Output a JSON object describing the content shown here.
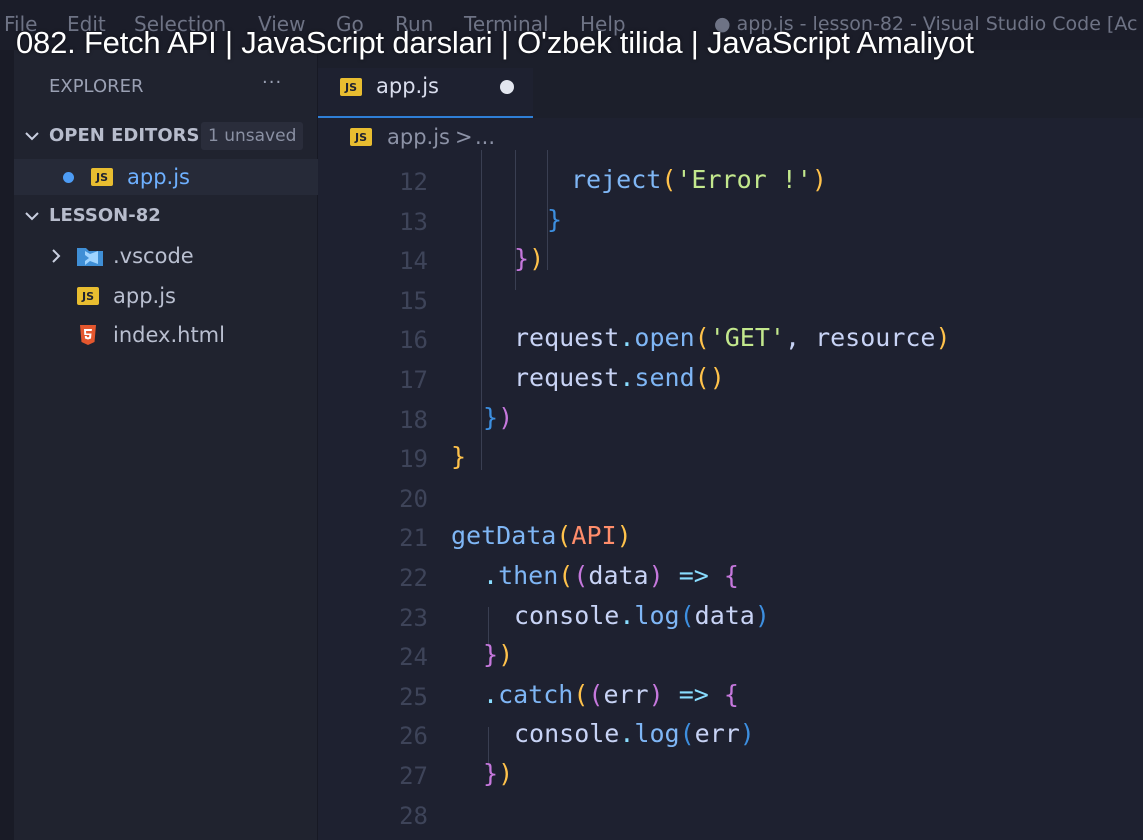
{
  "menu": {
    "items": [
      "File",
      "Edit",
      "Selection",
      "View",
      "Go",
      "Run",
      "Terminal",
      "Help"
    ],
    "window_title": "● app.js - lesson-82 - Visual Studio Code [Ac"
  },
  "video_title": "082. Fetch API | JavaScript darslari | O'zbek tilida | JavaScript Amaliyot",
  "sidebar": {
    "header": "EXPLORER",
    "more": "···",
    "open_editors": {
      "label": "OPEN EDITORS",
      "badge": "1 unsaved",
      "files": [
        {
          "name": "app.js",
          "icon": "js-file-icon",
          "unsaved": true
        }
      ]
    },
    "project": {
      "label": "LESSON-82",
      "items": [
        {
          "name": ".vscode",
          "icon": "vscode-folder-icon",
          "type": "folder"
        },
        {
          "name": "app.js",
          "icon": "js-file-icon",
          "type": "file"
        },
        {
          "name": "index.html",
          "icon": "html5-file-icon",
          "type": "file"
        }
      ]
    }
  },
  "editor": {
    "tab": {
      "label": "app.js",
      "icon": "js-file-icon",
      "unsaved": true
    },
    "breadcrumb": {
      "file": "app.js",
      "separator": ">",
      "more": "..."
    },
    "lines": [
      {
        "n": "12",
        "tokens": [
          [
            "reject",
            "fn"
          ],
          [
            "(",
            "p1"
          ],
          [
            "'Error !'",
            "str"
          ],
          [
            ")",
            "p1"
          ]
        ]
      },
      {
        "n": "13",
        "tokens": [
          [
            "}",
            "p3"
          ]
        ]
      },
      {
        "n": "14",
        "tokens": [
          [
            "}",
            "p2"
          ],
          [
            ")",
            "p1"
          ]
        ]
      },
      {
        "n": "15",
        "tokens": []
      },
      {
        "n": "16",
        "tokens": [
          [
            "request",
            "id"
          ],
          [
            ".",
            "op"
          ],
          [
            "open",
            "fn"
          ],
          [
            "(",
            "p1"
          ],
          [
            "'GET'",
            "str"
          ],
          [
            ", ",
            "pun"
          ],
          [
            "resource",
            "id"
          ],
          [
            ")",
            "p1"
          ]
        ]
      },
      {
        "n": "17",
        "tokens": [
          [
            "request",
            "id"
          ],
          [
            ".",
            "op"
          ],
          [
            "send",
            "fn"
          ],
          [
            "(",
            "p1"
          ],
          [
            ")",
            "p1"
          ]
        ]
      },
      {
        "n": "18",
        "tokens": [
          [
            "}",
            "p3"
          ],
          [
            ")",
            "p2"
          ]
        ]
      },
      {
        "n": "19",
        "tokens": [
          [
            "}",
            "p1"
          ]
        ]
      },
      {
        "n": "20",
        "tokens": []
      },
      {
        "n": "21",
        "tokens": [
          [
            "getData",
            "fn"
          ],
          [
            "(",
            "p1"
          ],
          [
            "API",
            "par"
          ],
          [
            ")",
            "p1"
          ]
        ]
      },
      {
        "n": "22",
        "tokens": [
          [
            ".",
            "op"
          ],
          [
            "then",
            "fn"
          ],
          [
            "(",
            "p1"
          ],
          [
            "(",
            "p2"
          ],
          [
            "data",
            "id"
          ],
          [
            ")",
            "p2"
          ],
          [
            " ",
            "pun"
          ],
          [
            "=>",
            "op"
          ],
          [
            " ",
            "pun"
          ],
          [
            "{",
            "p2"
          ]
        ]
      },
      {
        "n": "23",
        "tokens": [
          [
            "console",
            "id"
          ],
          [
            ".",
            "op"
          ],
          [
            "log",
            "fn"
          ],
          [
            "(",
            "p3"
          ],
          [
            "data",
            "id"
          ],
          [
            ")",
            "p3"
          ]
        ]
      },
      {
        "n": "24",
        "tokens": [
          [
            "}",
            "p2"
          ],
          [
            ")",
            "p1"
          ]
        ]
      },
      {
        "n": "25",
        "tokens": [
          [
            ".",
            "op"
          ],
          [
            "catch",
            "fn"
          ],
          [
            "(",
            "p1"
          ],
          [
            "(",
            "p2"
          ],
          [
            "err",
            "id"
          ],
          [
            ")",
            "p2"
          ],
          [
            " ",
            "pun"
          ],
          [
            "=>",
            "op"
          ],
          [
            " ",
            "pun"
          ],
          [
            "{",
            "p2"
          ]
        ]
      },
      {
        "n": "26",
        "tokens": [
          [
            "console",
            "id"
          ],
          [
            ".",
            "op"
          ],
          [
            "log",
            "fn"
          ],
          [
            "(",
            "p3"
          ],
          [
            "err",
            "id"
          ],
          [
            ")",
            "p3"
          ]
        ]
      },
      {
        "n": "27",
        "tokens": [
          [
            "}",
            "p2"
          ],
          [
            ")",
            "p1"
          ]
        ]
      },
      {
        "n": "28",
        "tokens": []
      }
    ]
  },
  "colors": {
    "accent": "#2f7fd6",
    "unsaved_dot": "#4d9cf5",
    "js_icon": "#e8bd30",
    "html_icon": "#e4572e",
    "vscode_folder": "#4aa3e8"
  }
}
